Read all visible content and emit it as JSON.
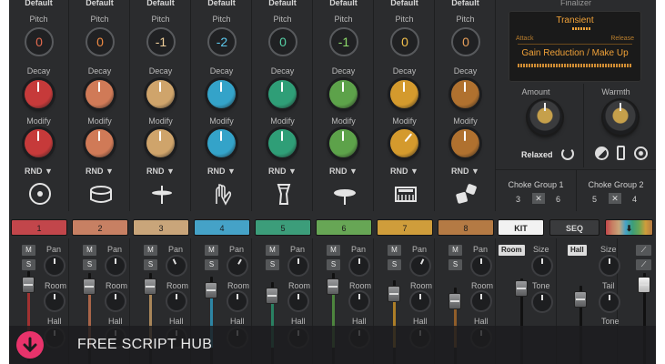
{
  "pads": [
    {
      "header": "Default",
      "pitch": "0",
      "color": "#c63a3a",
      "pitch_color": "#e36a4f",
      "modify_turned": false,
      "icon": "kick-drum-icon",
      "tab": "1",
      "tab_color": "#c2464b"
    },
    {
      "header": "Default",
      "pitch": "0",
      "color": "#d07a57",
      "pitch_color": "#f08b43",
      "modify_turned": false,
      "icon": "snare-drum-icon",
      "tab": "2",
      "tab_color": "#c78063"
    },
    {
      "header": "Default",
      "pitch": "-1",
      "color": "#cfa46b",
      "pitch_color": "#f0cf9a",
      "modify_turned": false,
      "icon": "hihat-cymbal-icon",
      "tab": "3",
      "tab_color": "#c9a57a"
    },
    {
      "header": "Default",
      "pitch": "-2",
      "color": "#34a3c9",
      "pitch_color": "#5cc9ee",
      "modify_turned": false,
      "icon": "clap-hands-icon",
      "tab": "4",
      "tab_color": "#45a2c7"
    },
    {
      "header": "Default",
      "pitch": "0",
      "color": "#2f9e77",
      "pitch_color": "#56d0a5",
      "modify_turned": false,
      "icon": "djembe-drum-icon",
      "tab": "5",
      "tab_color": "#3c9d7a"
    },
    {
      "header": "Default",
      "pitch": "-1",
      "color": "#5da24a",
      "pitch_color": "#8edc6b",
      "modify_turned": false,
      "icon": "ride-cymbal-icon",
      "tab": "6",
      "tab_color": "#67a655"
    },
    {
      "header": "Default",
      "pitch": "0",
      "color": "#d49a2d",
      "pitch_color": "#f3c14c",
      "modify_turned": true,
      "icon": "synth-keyboard-icon",
      "tab": "7",
      "tab_color": "#cf9d3b"
    },
    {
      "header": "Default",
      "pitch": "0",
      "color": "#b0712f",
      "pitch_color": "#e8a05a",
      "modify_turned": false,
      "icon": "dice-icon",
      "tab": "8",
      "tab_color": "#b47a44"
    }
  ],
  "labels": {
    "pitch": "Pitch",
    "decay": "Decay",
    "modify": "Modify",
    "rnd": "RND ▼"
  },
  "finalizer": {
    "title": "Finalizer",
    "transient": "Transient",
    "attack": "Attack",
    "release": "Release",
    "gain_reduction": "Gain Reduction / Make Up",
    "amount": "Amount",
    "warmth": "Warmth",
    "relaxed": "Relaxed"
  },
  "choke": [
    {
      "title": "Choke Group 1",
      "left": "3",
      "right": "6"
    },
    {
      "title": "Choke Group 2",
      "left": "5",
      "right": "4"
    }
  ],
  "tabs_extra": {
    "kit": "KIT",
    "seq": "SEQ"
  },
  "mixer": {
    "m": "M",
    "s": "S",
    "pan": "Pan",
    "room": "Room",
    "hall": "Hall",
    "fx_room": {
      "chip": "Room",
      "size": "Size",
      "tone": "Tone"
    },
    "fx_hall": {
      "chip": "Hall",
      "size": "Size",
      "tail": "Tail",
      "tone": "Tone"
    }
  },
  "banner": {
    "text": "FREE SCRIPT HUB",
    "accent": "#e8336b"
  }
}
